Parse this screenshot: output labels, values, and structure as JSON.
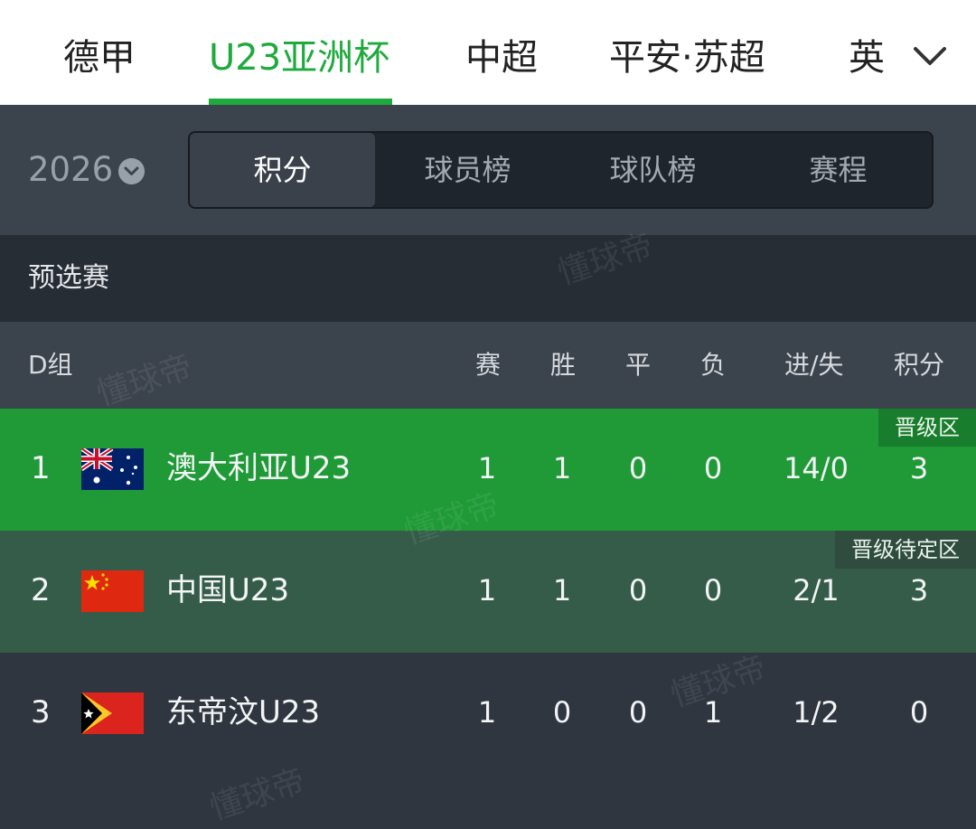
{
  "top_tabs": [
    {
      "label": "德甲",
      "active": false
    },
    {
      "label": "U23亚洲杯",
      "active": true
    },
    {
      "label": "中超",
      "active": false
    },
    {
      "label": "平安·苏超",
      "active": false
    },
    {
      "label": "英",
      "active": false
    }
  ],
  "season": {
    "year": "2026"
  },
  "segments": [
    {
      "label": "积分",
      "active": true
    },
    {
      "label": "球员榜",
      "active": false
    },
    {
      "label": "球队榜",
      "active": false
    },
    {
      "label": "赛程",
      "active": false
    }
  ],
  "stage": "预选赛",
  "table": {
    "group": "D组",
    "columns": [
      "赛",
      "胜",
      "平",
      "负",
      "进/失",
      "积分"
    ],
    "rows": [
      {
        "rank": "1",
        "team": "澳大利亚U23",
        "played": "1",
        "won": "1",
        "drawn": "0",
        "lost": "0",
        "goals": "14/0",
        "points": "3",
        "zone": "晋级区",
        "row_color": "#1f9a37",
        "tag_color": "#187d2c",
        "flag": "australia-flag-icon"
      },
      {
        "rank": "2",
        "team": "中国U23",
        "played": "1",
        "won": "1",
        "drawn": "0",
        "lost": "0",
        "goals": "2/1",
        "points": "3",
        "zone": "晋级待定区",
        "row_color": "#355c49",
        "tag_color": "#2f4c3f",
        "flag": "china-flag-icon"
      },
      {
        "rank": "3",
        "team": "东帝汶U23",
        "played": "1",
        "won": "0",
        "drawn": "0",
        "lost": "1",
        "goals": "1/2",
        "points": "0",
        "row_color": "#2f3640",
        "flag": "timor-leste-flag-icon"
      }
    ]
  },
  "watermark": "懂球帝",
  "colors": {
    "accent": "#1eaa3c"
  }
}
